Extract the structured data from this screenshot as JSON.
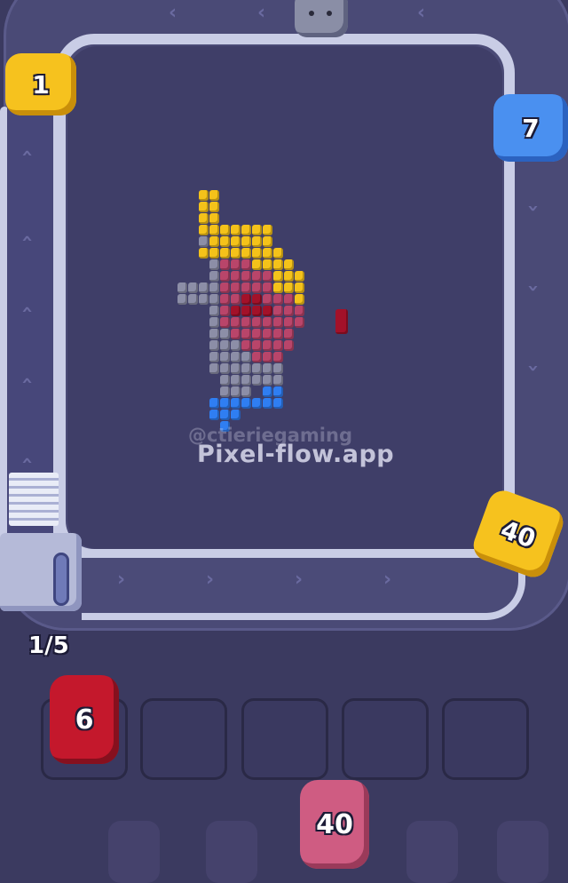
{
  "watermark": {
    "handle": "@ctieriegaming",
    "site": "Pixel-flow.app"
  },
  "queue_counter": "1/5",
  "track_shooters": [
    {
      "id": "yellow-top-left",
      "count": "1",
      "color": "#f6c21e"
    },
    {
      "id": "blue-right",
      "count": "7",
      "color": "#4a90f0"
    },
    {
      "id": "yellow-bottom-right",
      "count": "40",
      "color": "#f6c21e"
    }
  ],
  "slot_shooters": [
    {
      "id": "red-slot-1",
      "count": "6",
      "color": "#c4182c"
    }
  ],
  "next_shooter": {
    "count": "40",
    "color": "#cf5c82"
  },
  "slots_total": 5,
  "colors": {
    "yellow": "#f4c21a",
    "pink": "#b9456a",
    "dark_red": "#a31129",
    "gray": "#8c8ea7",
    "blue": "#2f7ef2",
    "rail": "#c9cde6",
    "background": "#3b3a60"
  }
}
